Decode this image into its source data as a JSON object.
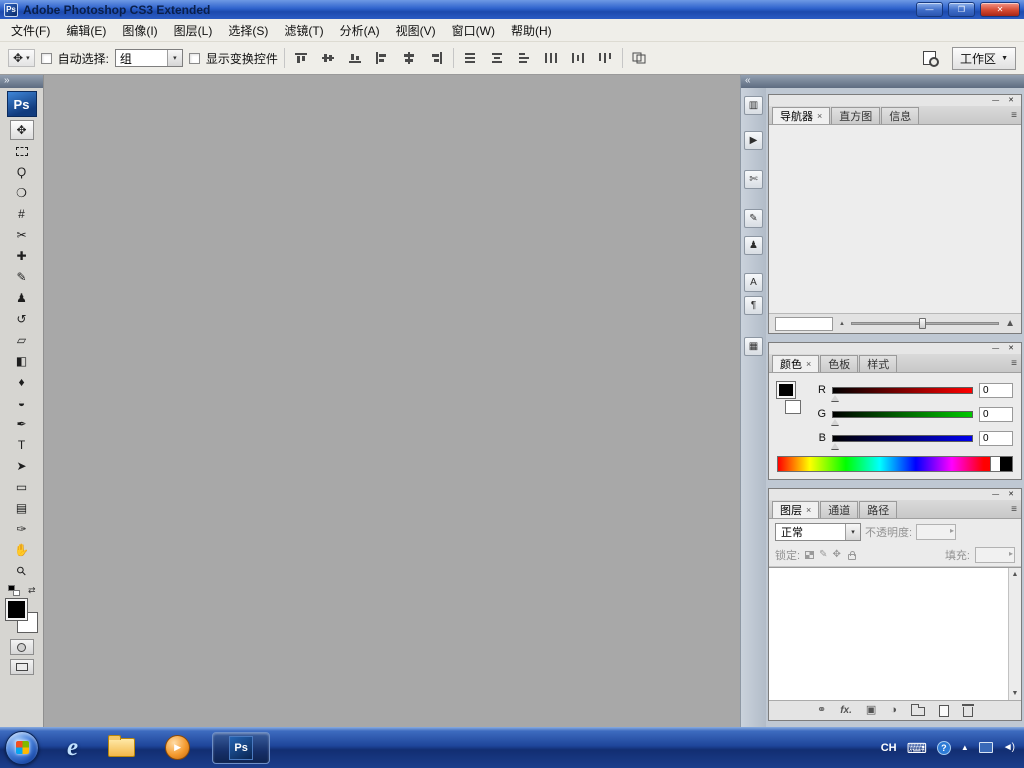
{
  "ui": {
    "dd": "▾",
    "flyout": "≡",
    "spinner": "▸",
    "scroll_up": "▲",
    "scroll_down": "▼"
  },
  "titlebar": {
    "app_icon": "Ps",
    "title": "Adobe Photoshop CS3 Extended",
    "minimize_glyph": "—",
    "restore_glyph": "❐",
    "close_glyph": "✕"
  },
  "menubar": {
    "items": [
      {
        "label": "文件(F)"
      },
      {
        "label": "编辑(E)"
      },
      {
        "label": "图像(I)"
      },
      {
        "label": "图层(L)"
      },
      {
        "label": "选择(S)"
      },
      {
        "label": "滤镜(T)"
      },
      {
        "label": "分析(A)"
      },
      {
        "label": "视图(V)"
      },
      {
        "label": "窗口(W)"
      },
      {
        "label": "帮助(H)"
      }
    ]
  },
  "options": {
    "tool_icon": "✥",
    "auto_select_label": "自动选择:",
    "auto_select_value": "组",
    "show_transform_label": "显示变换控件",
    "workspace_label": "工作区",
    "workspace_arrow": "▼"
  },
  "tooldock": {
    "collapse_glyph": "»",
    "logo": "Ps",
    "tools": [
      {
        "name": "move-tool",
        "glyph": "✥"
      },
      {
        "name": "rectangular-marquee-tool",
        "glyph": ""
      },
      {
        "name": "lasso-tool",
        "glyph": "Ϙ"
      },
      {
        "name": "quick-selection-tool",
        "glyph": "❍"
      },
      {
        "name": "crop-tool",
        "glyph": "#"
      },
      {
        "name": "slice-tool",
        "glyph": "✂"
      },
      {
        "name": "spot-healing-brush-tool",
        "glyph": "✚"
      },
      {
        "name": "brush-tool",
        "glyph": "✎"
      },
      {
        "name": "clone-stamp-tool",
        "glyph": "♟"
      },
      {
        "name": "history-brush-tool",
        "glyph": "↺"
      },
      {
        "name": "eraser-tool",
        "glyph": "▱"
      },
      {
        "name": "gradient-tool",
        "glyph": "◧"
      },
      {
        "name": "blur-tool",
        "glyph": "♦"
      },
      {
        "name": "dodge-tool",
        "glyph": "◒"
      },
      {
        "name": "pen-tool",
        "glyph": "✒"
      },
      {
        "name": "type-tool",
        "glyph": "T"
      },
      {
        "name": "path-selection-tool",
        "glyph": "➤"
      },
      {
        "name": "rectangle-tool",
        "glyph": "▭"
      },
      {
        "name": "notes-tool",
        "glyph": "▤"
      },
      {
        "name": "eyedropper-tool",
        "glyph": "✑"
      },
      {
        "name": "hand-tool",
        "glyph": "✋"
      },
      {
        "name": "zoom-tool",
        "glyph": "⚲"
      }
    ],
    "swap_glyph": "⇄",
    "foreground_color": "#000000",
    "background_color": "#ffffff"
  },
  "icon_dock": {
    "expand_glyph": "«",
    "icons": [
      {
        "name": "history-panel",
        "glyph": "▥"
      },
      {
        "name": "actions-panel",
        "glyph": "▶"
      },
      {
        "name": "tool-presets-panel",
        "glyph": "✄"
      },
      {
        "name": "brushes-panel",
        "glyph": "✎"
      },
      {
        "name": "clone-source-panel",
        "glyph": "♟"
      },
      {
        "name": "character-panel",
        "glyph": "A"
      },
      {
        "name": "paragraph-panel",
        "glyph": "¶"
      },
      {
        "name": "layer-comps-panel",
        "glyph": "▦"
      }
    ]
  },
  "navigator_panel": {
    "minimize_glyph": "—",
    "close_glyph": "✕",
    "tabs": [
      {
        "label": "导航器",
        "close": "×"
      },
      {
        "label": "直方图"
      },
      {
        "label": "信息"
      }
    ],
    "zoom_value": "",
    "zoom_out_glyph": "▲",
    "zoom_in_glyph": "▲"
  },
  "color_panel": {
    "minimize_glyph": "—",
    "close_glyph": "✕",
    "tabs": [
      {
        "label": "颜色",
        "close": "×"
      },
      {
        "label": "色板"
      },
      {
        "label": "样式"
      }
    ],
    "channels": [
      {
        "label": "R",
        "value": "0",
        "color": "#ff0000"
      },
      {
        "label": "G",
        "value": "0",
        "color": "#00c800"
      },
      {
        "label": "B",
        "value": "0",
        "color": "#0000f0"
      }
    ]
  },
  "layers_panel": {
    "minimize_glyph": "—",
    "close_glyph": "✕",
    "tabs": [
      {
        "label": "图层",
        "close": "×"
      },
      {
        "label": "通道"
      },
      {
        "label": "路径"
      }
    ],
    "blend_mode_value": "正常",
    "opacity_label": "不透明度:",
    "lock_label": "锁定:",
    "fill_label": "填充:",
    "lock_icons": {
      "image": "✎",
      "position": "✥"
    },
    "footer": {
      "link": "⚭",
      "fx": "fx.",
      "mask": "▣",
      "adjust": "◑"
    }
  },
  "taskbar": {
    "ps_button_label": "Ps",
    "quick_launch": {
      "ie": "e",
      "wmp": "▶"
    },
    "tray": {
      "language": "CH",
      "keyboard": "⌨",
      "help": "?",
      "hidden_icons": "▲",
      "volume": "◄)"
    }
  }
}
